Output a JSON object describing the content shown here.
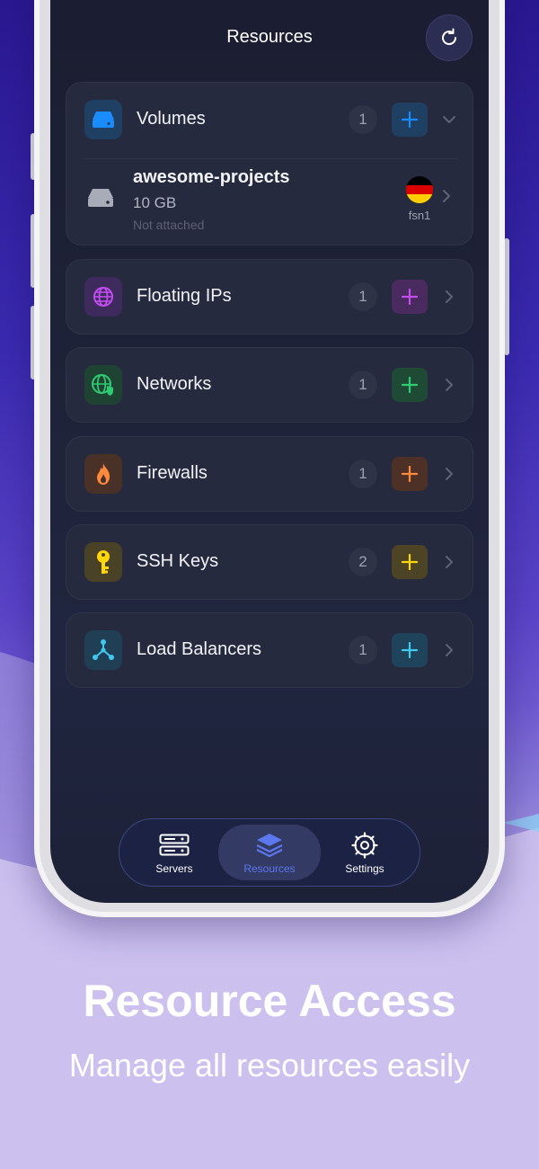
{
  "screen": {
    "title": "Resources",
    "refresh_icon": "refresh-icon"
  },
  "volumes": {
    "label": "Volumes",
    "count": "1",
    "icon": "drive-icon",
    "accent": "#1a8cff",
    "expanded": true,
    "items": [
      {
        "name": "awesome-projects",
        "size": "10 GB",
        "status": "Not attached",
        "location": "fsn1",
        "flag": "germany-flag-icon"
      }
    ]
  },
  "resources": [
    {
      "label": "Floating IPs",
      "count": "1",
      "icon": "globe-icon",
      "accent": "#c44cf0"
    },
    {
      "label": "Networks",
      "count": "1",
      "icon": "network-shield-icon",
      "accent": "#2ecc71"
    },
    {
      "label": "Firewalls",
      "count": "1",
      "icon": "flame-icon",
      "accent": "#ff8a3d"
    },
    {
      "label": "SSH Keys",
      "count": "2",
      "icon": "key-icon",
      "accent": "#ffd60a"
    },
    {
      "label": "Load Balancers",
      "count": "1",
      "icon": "load-balancer-icon",
      "accent": "#3fc8f0"
    }
  ],
  "tabbar": {
    "active": "Resources",
    "tabs": [
      {
        "label": "Servers",
        "icon": "server-rack-icon"
      },
      {
        "label": "Resources",
        "icon": "layers-icon"
      },
      {
        "label": "Settings",
        "icon": "gear-icon"
      }
    ]
  },
  "promo": {
    "headline": "Resource Access",
    "subheadline": "Manage all resources easily"
  }
}
